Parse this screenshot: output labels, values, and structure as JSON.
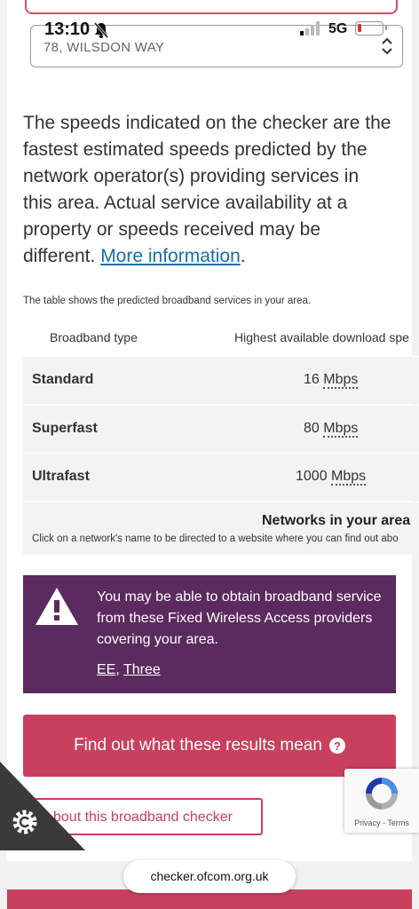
{
  "status_bar": {
    "time": "13:10",
    "network": "5G"
  },
  "address_select": {
    "value": "78, WILSDON WAY"
  },
  "intro": {
    "text": "The speeds indicated on the checker are the fastest estimated speeds predicted by the network operator(s) providing services in this area. Actual service availability at a property or speeds received may be different.",
    "link": "More information",
    "suffix": "."
  },
  "table": {
    "caption": "The table shows the predicted broadband services in your area.",
    "headers": [
      "Broadband type",
      "Highest available download spe"
    ],
    "rows": [
      {
        "type": "Standard",
        "speed": "16",
        "unit": "Mbps"
      },
      {
        "type": "Superfast",
        "speed": "80",
        "unit": "Mbps"
      },
      {
        "type": "Ultrafast",
        "speed": "1000",
        "unit": "Mbps"
      }
    ],
    "networks_title": "Networks in your area",
    "networks_desc": "Click on a network's name to be directed to a website where you can find out abo"
  },
  "fwa_notice": {
    "message": "You may be able to obtain broadband service from these Fixed Wireless Access providers covering your area.",
    "providers": [
      "EE",
      "Three"
    ],
    "separator": ", "
  },
  "cta_button": {
    "label": "Find out what these results mean"
  },
  "about_button": {
    "label": "bout this broadband checker"
  },
  "recaptcha": {
    "privacy": "Privacy",
    "sep": " - ",
    "terms": "Terms"
  },
  "url_bar": {
    "url": "checker.ofcom.org.uk"
  },
  "colors": {
    "accent": "#c9405f",
    "notice_bg": "#5b2a5e",
    "link": "#1a6fa8"
  }
}
